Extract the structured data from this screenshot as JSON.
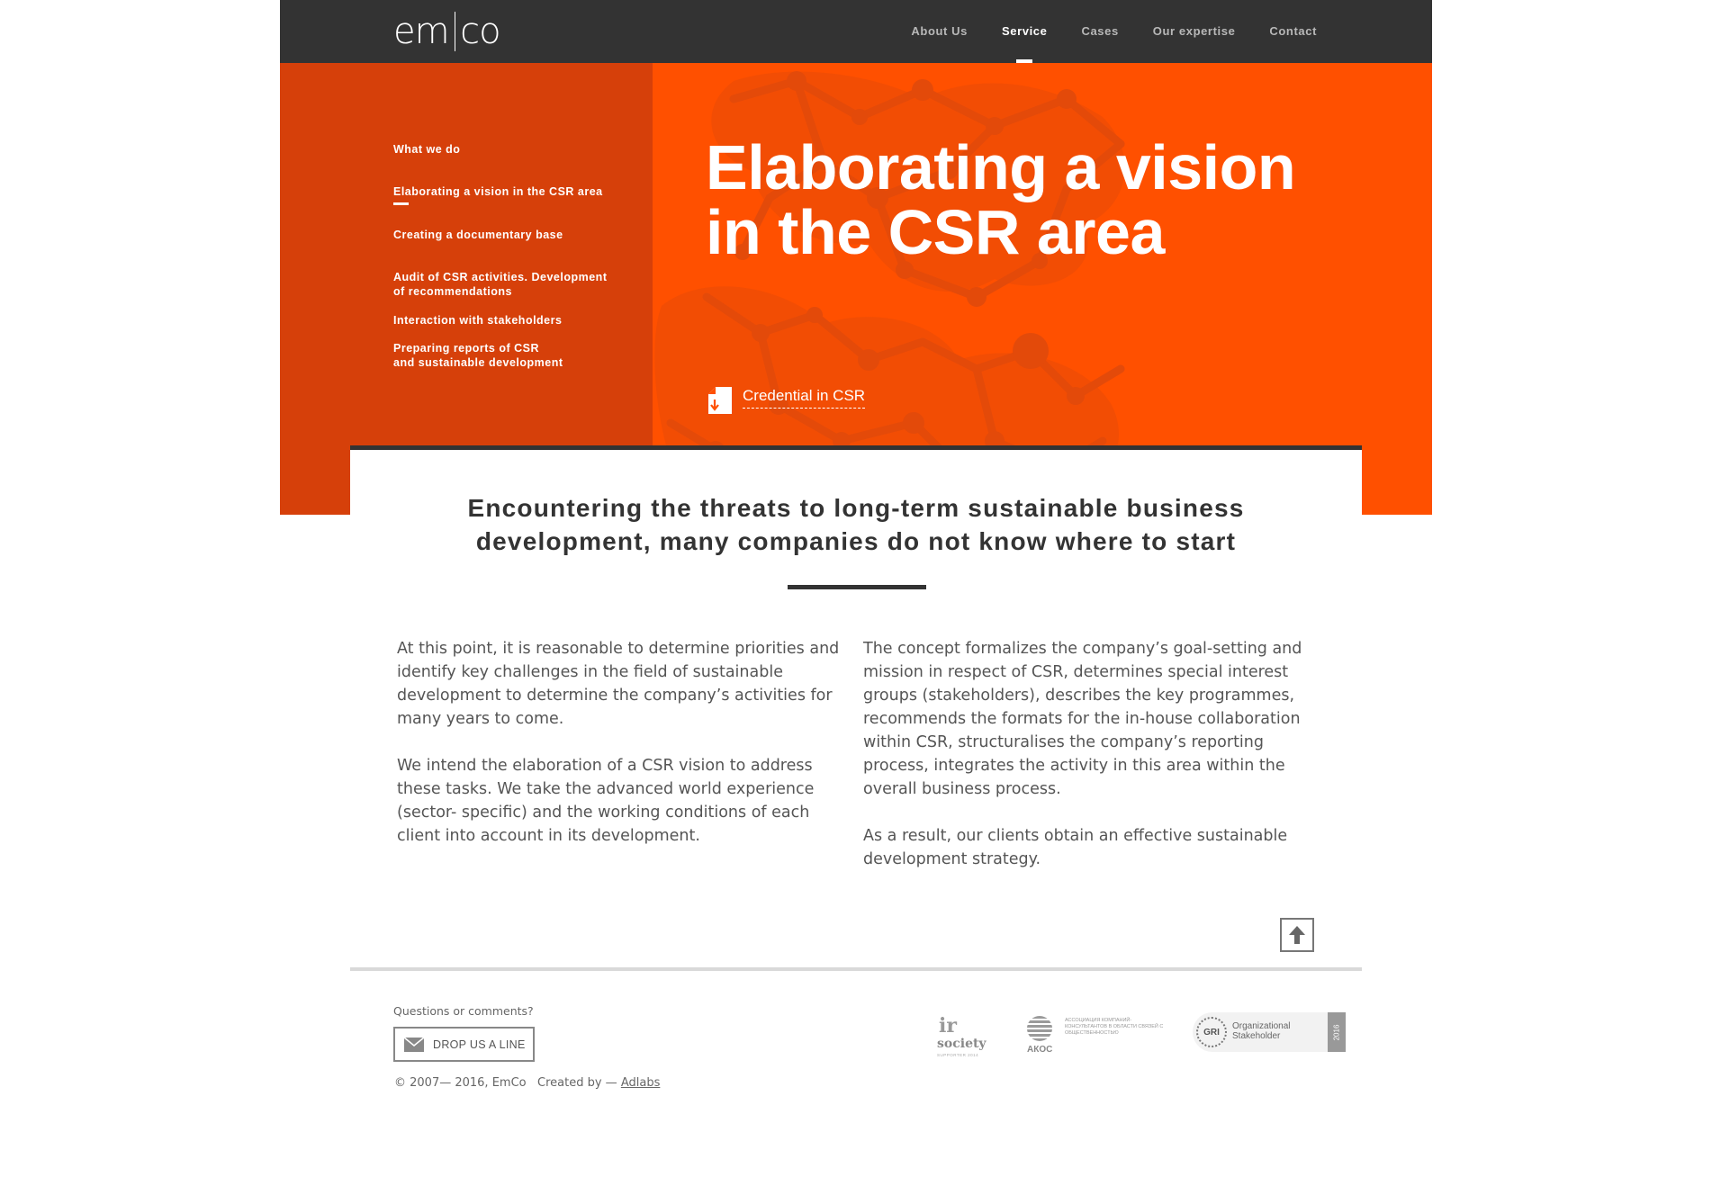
{
  "header": {
    "logo": {
      "part1": "em",
      "part2": "co"
    },
    "nav": [
      {
        "label": "About Us"
      },
      {
        "label": "Service",
        "active": true
      },
      {
        "label": "Cases"
      },
      {
        "label": "Our expertise"
      },
      {
        "label": "Contact"
      }
    ]
  },
  "submenu": {
    "heading": "What we do",
    "items": [
      {
        "line1": "Elaborating a vision in the CSR area",
        "line2": "",
        "active": true
      },
      {
        "line1": "Creating a documentary base",
        "line2": ""
      },
      {
        "line1": "Audit of CSR activities. Development",
        "line2": "of recommendations"
      },
      {
        "line1": "Interaction with stakeholders",
        "line2": ""
      },
      {
        "line1": "Preparing reports of CSR",
        "line2": "and sustainable development"
      }
    ]
  },
  "hero": {
    "title_line1": "Elaborating a vision",
    "title_line2": "in the CSR area",
    "credential_label": "Credential in CSR",
    "credential_icon": "download-document-icon"
  },
  "content": {
    "lead_line1": "Encountering the threats to long-term sustainable business",
    "lead_line2": "development, many companies do not know where to start",
    "left_paragraphs": [
      "At this point, it is reasonable to determine priorities and identify key challenges in the field of sustainable development to determine the company’s activities for many years to come.",
      "We intend the elaboration of a CSR vision to address these tasks. We take the advanced world experience (sector- specific) and the working conditions of each client into account in its development."
    ],
    "right_paragraphs": [
      "The concept formalizes the company’s goal-setting and mission in respect of CSR, determines special interest groups (stakeholders), describes the key programmes, recommends the formats for the in-house collaboration within CSR, structuralises the company’s reporting process, integrates the activity in this area within the overall business process.",
      "As a result, our clients obtain an effective sustainable development strategy."
    ],
    "scroll_top_icon": "arrow-up-icon"
  },
  "footer": {
    "questions": "Questions or comments?",
    "drop_label": "DROP US A LINE",
    "drop_icon": "envelope-icon",
    "copyright": "© 2007— 2016, EmCo",
    "created_by": "Created by —",
    "creator_link": "Adlabs",
    "partners": {
      "ir_mark": "ir",
      "ir_name": "society",
      "ir_sub": "SUPPORTER 2014",
      "akos_name": "АКОС",
      "akos_text": "АССОЦИАЦИЯ КОМПАНИЙ-КОНСУЛЬТАНТОВ В ОБЛАСТИ СВЯЗЕЙ С ОБЩЕСТВЕННОСТЬЮ",
      "gri_mark": "GRI",
      "gri_text1": "Organizational",
      "gri_text2": "Stakeholder",
      "gri_year": "2016"
    }
  },
  "colors": {
    "header_bg": "#333333",
    "hero_left": "#d6400a",
    "hero_right": "#ff5000",
    "pattern": "#e34a0a",
    "text_dark": "#333333",
    "text_body": "#555555"
  }
}
